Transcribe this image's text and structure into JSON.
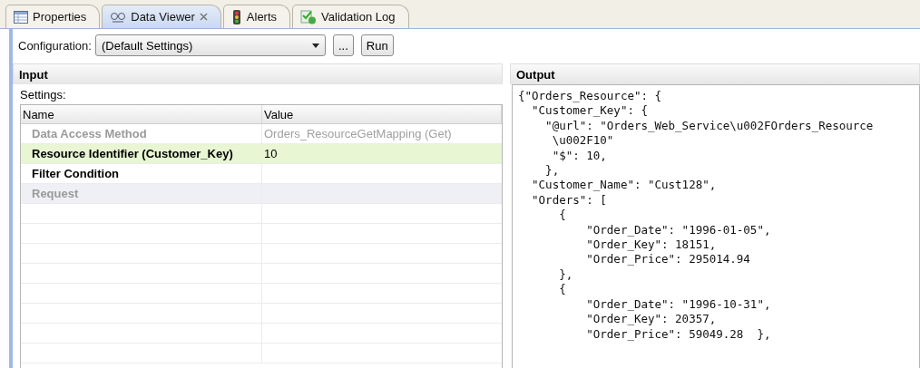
{
  "tabs": [
    {
      "label": "Properties",
      "selected": false,
      "closable": false
    },
    {
      "label": "Data Viewer",
      "selected": true,
      "closable": true
    },
    {
      "label": "Alerts",
      "selected": false,
      "closable": false
    },
    {
      "label": "Validation Log",
      "selected": false,
      "closable": false
    }
  ],
  "toolbar": {
    "configuration_label": "Configuration:",
    "configuration_value": "(Default Settings)",
    "more_button": "...",
    "run_button": "Run"
  },
  "input": {
    "title": "Input",
    "settings_label": "Settings:",
    "columns": [
      "Name",
      "Value"
    ],
    "rows": [
      {
        "name": "Data Access Method",
        "value": "Orders_ResourceGetMapping (Get)",
        "disabled": true,
        "selected": false
      },
      {
        "name": "Resource Identifier (Customer_Key)",
        "value": "10",
        "disabled": false,
        "selected": true
      },
      {
        "name": "Filter Condition",
        "value": "",
        "disabled": false,
        "selected": false
      },
      {
        "name": "Request",
        "value": "",
        "disabled": true,
        "selected": false
      }
    ]
  },
  "output": {
    "title": "Output",
    "lines": [
      "{\"Orders_Resource\": {",
      "  \"Customer_Key\": {",
      "    \"@url\": \"Orders_Web_Service\\u002FOrders_Resource",
      "     \\u002F10\"",
      "     \"$\": 10,",
      "    },",
      "  \"Customer_Name\": \"Cust128\",",
      "  \"Orders\": [",
      "      {",
      "          \"Order_Date\": \"1996-01-05\",",
      "          \"Order_Key\": 18151,",
      "          \"Order_Price\": 295014.94",
      "      },",
      "      {",
      "          \"Order_Date\": \"1996-10-31\",",
      "          \"Order_Key\": 20357,",
      "          \"Order_Price\": 59049.28  },"
    ]
  }
}
